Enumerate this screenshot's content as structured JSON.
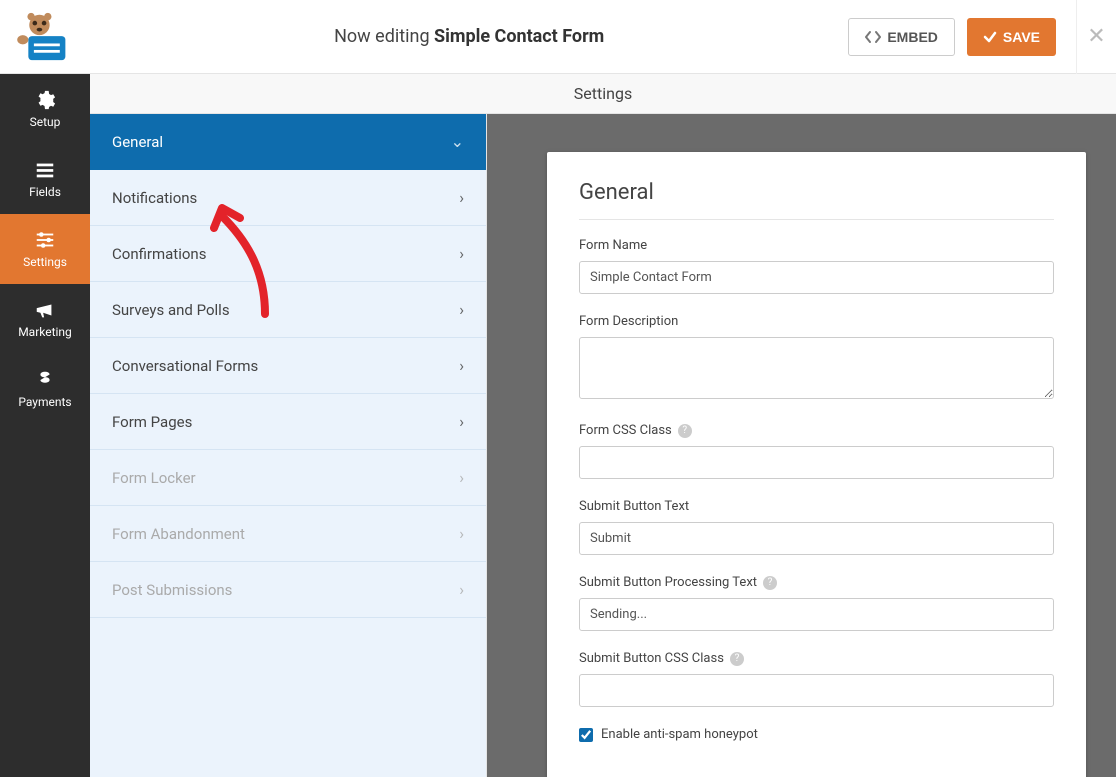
{
  "header": {
    "editing_prefix": "Now editing",
    "form_name": "Simple Contact Form",
    "embed_label": "EMBED",
    "save_label": "SAVE"
  },
  "sidebar": {
    "items": [
      {
        "id": "setup",
        "label": "Setup",
        "icon": "gear-icon"
      },
      {
        "id": "fields",
        "label": "Fields",
        "icon": "list-icon"
      },
      {
        "id": "settings",
        "label": "Settings",
        "icon": "sliders-icon",
        "active": true
      },
      {
        "id": "marketing",
        "label": "Marketing",
        "icon": "megaphone-icon"
      },
      {
        "id": "payments",
        "label": "Payments",
        "icon": "dollar-icon"
      }
    ]
  },
  "section_title": "Settings",
  "subnav": {
    "items": [
      {
        "label": "General",
        "active": true,
        "chevron": "down"
      },
      {
        "label": "Notifications",
        "chevron": "right"
      },
      {
        "label": "Confirmations",
        "chevron": "right"
      },
      {
        "label": "Surveys and Polls",
        "chevron": "right"
      },
      {
        "label": "Conversational Forms",
        "chevron": "right"
      },
      {
        "label": "Form Pages",
        "chevron": "right"
      },
      {
        "label": "Form Locker",
        "chevron": "right",
        "disabled": true
      },
      {
        "label": "Form Abandonment",
        "chevron": "right",
        "disabled": true
      },
      {
        "label": "Post Submissions",
        "chevron": "right",
        "disabled": true
      }
    ]
  },
  "panel": {
    "title": "General",
    "fields": {
      "form_name_label": "Form Name",
      "form_name_value": "Simple Contact Form",
      "form_description_label": "Form Description",
      "form_description_value": "",
      "form_css_class_label": "Form CSS Class",
      "form_css_class_value": "",
      "submit_text_label": "Submit Button Text",
      "submit_text_value": "Submit",
      "submit_processing_label": "Submit Button Processing Text",
      "submit_processing_value": "Sending...",
      "submit_css_class_label": "Submit Button CSS Class",
      "submit_css_class_value": "",
      "honeypot_label": "Enable anti-spam honeypot",
      "honeypot_checked": true
    }
  }
}
